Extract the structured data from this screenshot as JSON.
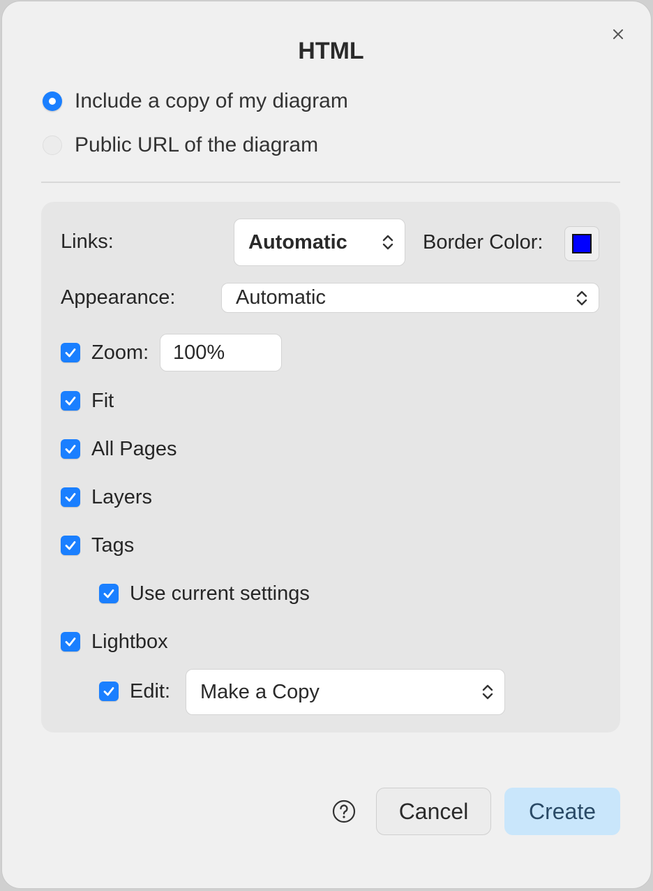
{
  "dialog": {
    "title": "HTML",
    "close_icon": "close-icon"
  },
  "source_options": [
    {
      "label": "Include a copy of my diagram",
      "selected": true
    },
    {
      "label": "Public URL of the diagram",
      "selected": false
    }
  ],
  "links": {
    "label": "Links:",
    "value": "Automatic"
  },
  "border_color": {
    "label": "Border Color:",
    "color": "#0000ff"
  },
  "appearance": {
    "label": "Appearance:",
    "value": "Automatic"
  },
  "zoom": {
    "label": "Zoom:",
    "value": "100%",
    "checked": true
  },
  "options": {
    "fit": {
      "label": "Fit",
      "checked": true
    },
    "all_pages": {
      "label": "All Pages",
      "checked": true
    },
    "layers": {
      "label": "Layers",
      "checked": true
    },
    "tags": {
      "label": "Tags",
      "checked": true
    },
    "use_current_settings": {
      "label": "Use current settings",
      "checked": true
    },
    "lightbox": {
      "label": "Lightbox",
      "checked": true
    }
  },
  "edit": {
    "label": "Edit:",
    "value": "Make a Copy",
    "checked": true
  },
  "footer": {
    "help_icon": "help-icon",
    "cancel_label": "Cancel",
    "create_label": "Create"
  },
  "colors": {
    "accent": "#1a7fff",
    "primary_button": "#c9e6fb"
  }
}
